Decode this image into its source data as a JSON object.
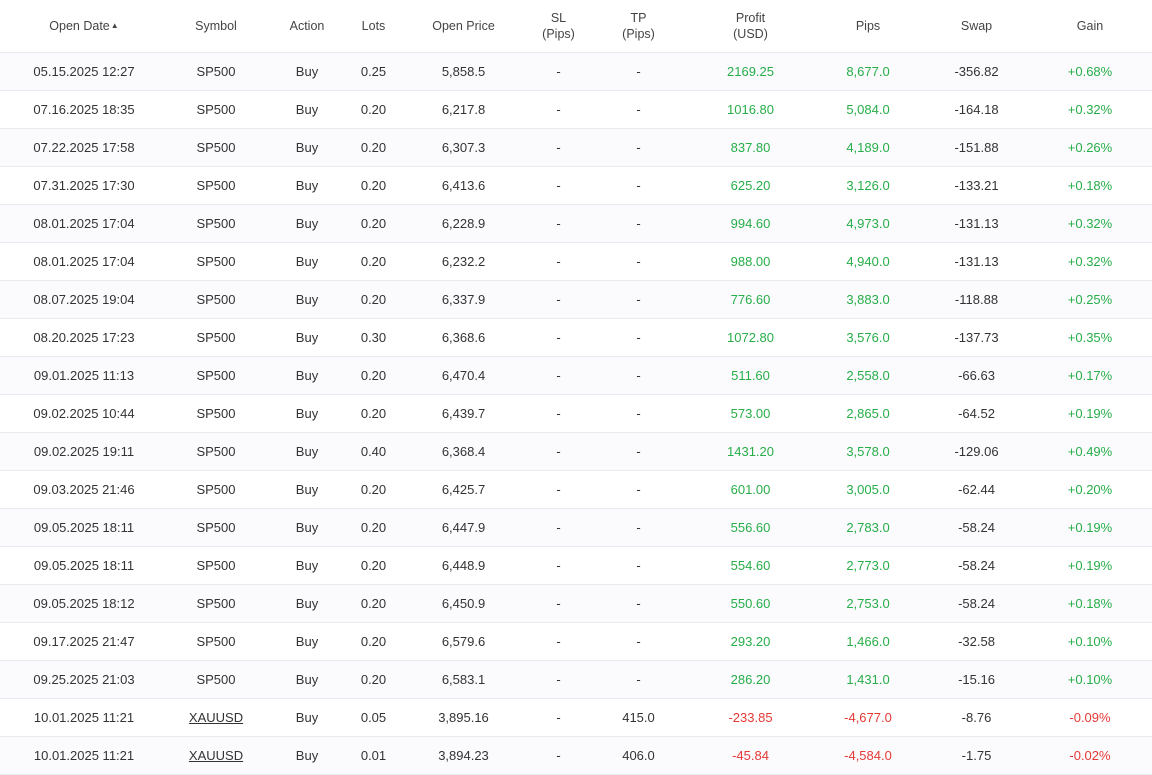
{
  "header": {
    "open_date": "Open Date",
    "sort_indicator": "▲",
    "symbol": "Symbol",
    "action": "Action",
    "lots": "Lots",
    "open_price": "Open Price",
    "sl": "SL",
    "sl_unit": "(Pips)",
    "tp": "TP",
    "tp_unit": "(Pips)",
    "profit": "Profit",
    "profit_unit": "(USD)",
    "pips": "Pips",
    "swap": "Swap",
    "gain": "Gain"
  },
  "colors": {
    "positive": "#27ae48",
    "negative": "#e53935"
  },
  "rows": [
    {
      "date": "05.15.2025 12:27",
      "symbol": "SP500",
      "symbol_link": false,
      "action": "Buy",
      "lots": "0.25",
      "open_price": "5,858.5",
      "sl": "-",
      "tp": "-",
      "profit": "2169.25",
      "pips": "8,677.0",
      "swap": "-356.82",
      "gain": "+0.68%",
      "positive": true
    },
    {
      "date": "07.16.2025 18:35",
      "symbol": "SP500",
      "symbol_link": false,
      "action": "Buy",
      "lots": "0.20",
      "open_price": "6,217.8",
      "sl": "-",
      "tp": "-",
      "profit": "1016.80",
      "pips": "5,084.0",
      "swap": "-164.18",
      "gain": "+0.32%",
      "positive": true
    },
    {
      "date": "07.22.2025 17:58",
      "symbol": "SP500",
      "symbol_link": false,
      "action": "Buy",
      "lots": "0.20",
      "open_price": "6,307.3",
      "sl": "-",
      "tp": "-",
      "profit": "837.80",
      "pips": "4,189.0",
      "swap": "-151.88",
      "gain": "+0.26%",
      "positive": true
    },
    {
      "date": "07.31.2025 17:30",
      "symbol": "SP500",
      "symbol_link": false,
      "action": "Buy",
      "lots": "0.20",
      "open_price": "6,413.6",
      "sl": "-",
      "tp": "-",
      "profit": "625.20",
      "pips": "3,126.0",
      "swap": "-133.21",
      "gain": "+0.18%",
      "positive": true
    },
    {
      "date": "08.01.2025 17:04",
      "symbol": "SP500",
      "symbol_link": false,
      "action": "Buy",
      "lots": "0.20",
      "open_price": "6,228.9",
      "sl": "-",
      "tp": "-",
      "profit": "994.60",
      "pips": "4,973.0",
      "swap": "-131.13",
      "gain": "+0.32%",
      "positive": true
    },
    {
      "date": "08.01.2025 17:04",
      "symbol": "SP500",
      "symbol_link": false,
      "action": "Buy",
      "lots": "0.20",
      "open_price": "6,232.2",
      "sl": "-",
      "tp": "-",
      "profit": "988.00",
      "pips": "4,940.0",
      "swap": "-131.13",
      "gain": "+0.32%",
      "positive": true
    },
    {
      "date": "08.07.2025 19:04",
      "symbol": "SP500",
      "symbol_link": false,
      "action": "Buy",
      "lots": "0.20",
      "open_price": "6,337.9",
      "sl": "-",
      "tp": "-",
      "profit": "776.60",
      "pips": "3,883.0",
      "swap": "-118.88",
      "gain": "+0.25%",
      "positive": true
    },
    {
      "date": "08.20.2025 17:23",
      "symbol": "SP500",
      "symbol_link": false,
      "action": "Buy",
      "lots": "0.30",
      "open_price": "6,368.6",
      "sl": "-",
      "tp": "-",
      "profit": "1072.80",
      "pips": "3,576.0",
      "swap": "-137.73",
      "gain": "+0.35%",
      "positive": true
    },
    {
      "date": "09.01.2025 11:13",
      "symbol": "SP500",
      "symbol_link": false,
      "action": "Buy",
      "lots": "0.20",
      "open_price": "6,470.4",
      "sl": "-",
      "tp": "-",
      "profit": "511.60",
      "pips": "2,558.0",
      "swap": "-66.63",
      "gain": "+0.17%",
      "positive": true
    },
    {
      "date": "09.02.2025 10:44",
      "symbol": "SP500",
      "symbol_link": false,
      "action": "Buy",
      "lots": "0.20",
      "open_price": "6,439.7",
      "sl": "-",
      "tp": "-",
      "profit": "573.00",
      "pips": "2,865.0",
      "swap": "-64.52",
      "gain": "+0.19%",
      "positive": true
    },
    {
      "date": "09.02.2025 19:11",
      "symbol": "SP500",
      "symbol_link": false,
      "action": "Buy",
      "lots": "0.40",
      "open_price": "6,368.4",
      "sl": "-",
      "tp": "-",
      "profit": "1431.20",
      "pips": "3,578.0",
      "swap": "-129.06",
      "gain": "+0.49%",
      "positive": true
    },
    {
      "date": "09.03.2025 21:46",
      "symbol": "SP500",
      "symbol_link": false,
      "action": "Buy",
      "lots": "0.20",
      "open_price": "6,425.7",
      "sl": "-",
      "tp": "-",
      "profit": "601.00",
      "pips": "3,005.0",
      "swap": "-62.44",
      "gain": "+0.20%",
      "positive": true
    },
    {
      "date": "09.05.2025 18:11",
      "symbol": "SP500",
      "symbol_link": false,
      "action": "Buy",
      "lots": "0.20",
      "open_price": "6,447.9",
      "sl": "-",
      "tp": "-",
      "profit": "556.60",
      "pips": "2,783.0",
      "swap": "-58.24",
      "gain": "+0.19%",
      "positive": true
    },
    {
      "date": "09.05.2025 18:11",
      "symbol": "SP500",
      "symbol_link": false,
      "action": "Buy",
      "lots": "0.20",
      "open_price": "6,448.9",
      "sl": "-",
      "tp": "-",
      "profit": "554.60",
      "pips": "2,773.0",
      "swap": "-58.24",
      "gain": "+0.19%",
      "positive": true
    },
    {
      "date": "09.05.2025 18:12",
      "symbol": "SP500",
      "symbol_link": false,
      "action": "Buy",
      "lots": "0.20",
      "open_price": "6,450.9",
      "sl": "-",
      "tp": "-",
      "profit": "550.60",
      "pips": "2,753.0",
      "swap": "-58.24",
      "gain": "+0.18%",
      "positive": true
    },
    {
      "date": "09.17.2025 21:47",
      "symbol": "SP500",
      "symbol_link": false,
      "action": "Buy",
      "lots": "0.20",
      "open_price": "6,579.6",
      "sl": "-",
      "tp": "-",
      "profit": "293.20",
      "pips": "1,466.0",
      "swap": "-32.58",
      "gain": "+0.10%",
      "positive": true
    },
    {
      "date": "09.25.2025 21:03",
      "symbol": "SP500",
      "symbol_link": false,
      "action": "Buy",
      "lots": "0.20",
      "open_price": "6,583.1",
      "sl": "-",
      "tp": "-",
      "profit": "286.20",
      "pips": "1,431.0",
      "swap": "-15.16",
      "gain": "+0.10%",
      "positive": true
    },
    {
      "date": "10.01.2025 11:21",
      "symbol": "XAUUSD",
      "symbol_link": true,
      "action": "Buy",
      "lots": "0.05",
      "open_price": "3,895.16",
      "sl": "-",
      "tp": "415.0",
      "profit": "-233.85",
      "pips": "-4,677.0",
      "swap": "-8.76",
      "gain": "-0.09%",
      "positive": false
    },
    {
      "date": "10.01.2025 11:21",
      "symbol": "XAUUSD",
      "symbol_link": true,
      "action": "Buy",
      "lots": "0.01",
      "open_price": "3,894.23",
      "sl": "-",
      "tp": "406.0",
      "profit": "-45.84",
      "pips": "-4,584.0",
      "swap": "-1.75",
      "gain": "-0.02%",
      "positive": false
    }
  ]
}
